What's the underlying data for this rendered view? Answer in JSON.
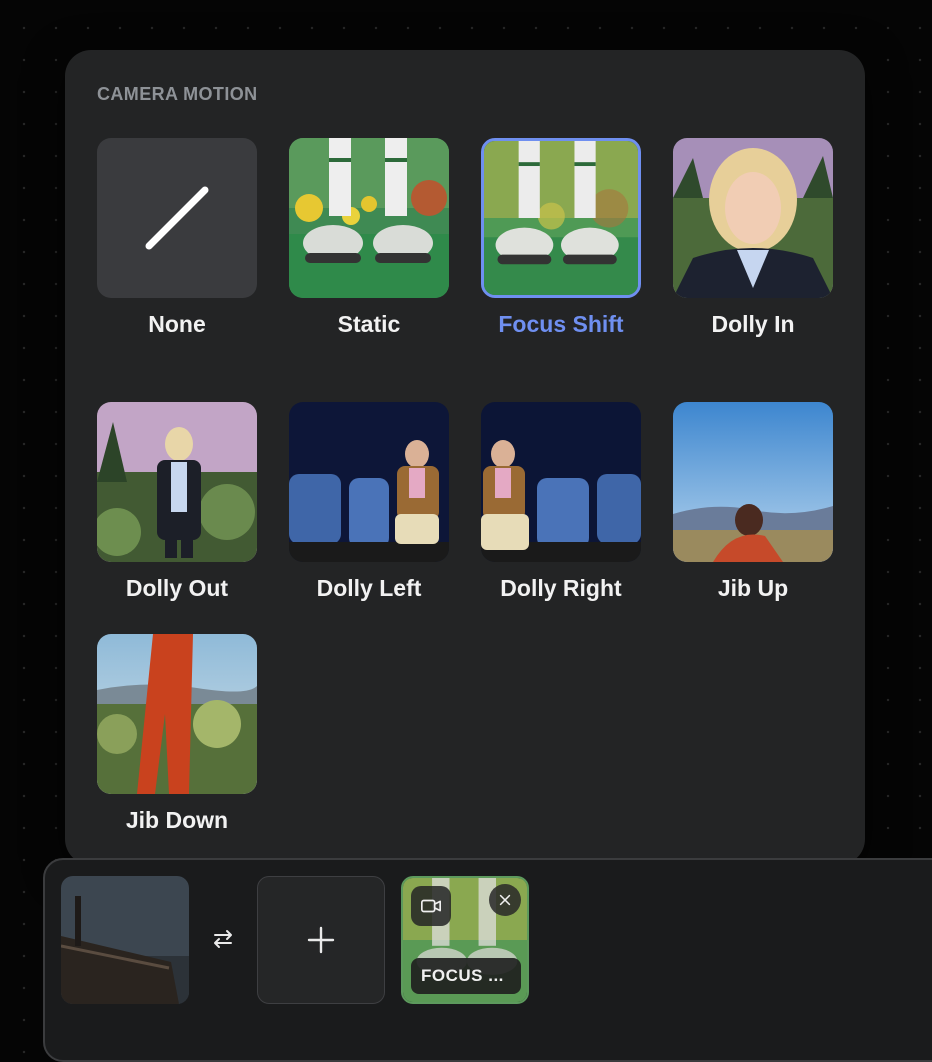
{
  "panel": {
    "title": "CAMERA MOTION",
    "options": [
      {
        "label": "None",
        "selected": false
      },
      {
        "label": "Static",
        "selected": false
      },
      {
        "label": "Focus Shift",
        "selected": true
      },
      {
        "label": "Dolly In",
        "selected": false
      },
      {
        "label": "Dolly Out",
        "selected": false
      },
      {
        "label": "Dolly Left",
        "selected": false
      },
      {
        "label": "Dolly Right",
        "selected": false
      },
      {
        "label": "Jib Up",
        "selected": false
      },
      {
        "label": "Jib Down",
        "selected": false
      }
    ]
  },
  "tray": {
    "add_icon": "plus-icon",
    "swap_icon": "swap-arrows-icon",
    "motion_chip": "FOCUS ...",
    "camera_icon": "video-camera-icon",
    "close_icon": "close-icon"
  },
  "colors": {
    "panel_bg": "#232425",
    "accent": "#6f8ff0",
    "label": "#f2f2f2",
    "section_title": "#8e9297"
  }
}
